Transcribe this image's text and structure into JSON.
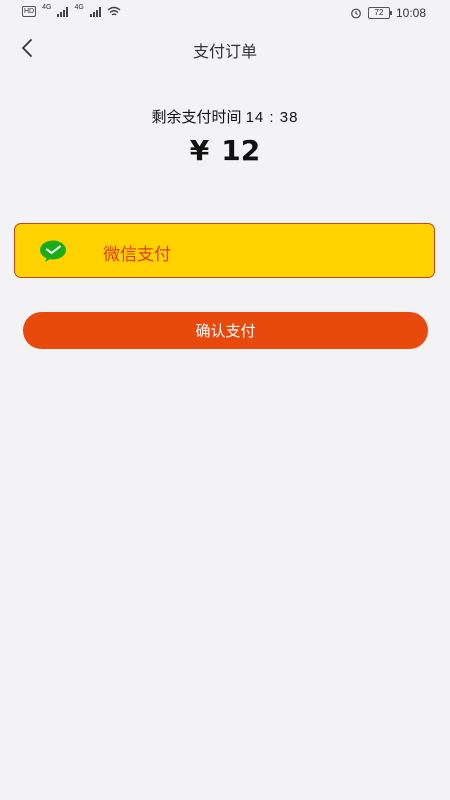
{
  "status_bar": {
    "hd_label": "HD",
    "net1": "4G",
    "net2": "4G",
    "battery": "72",
    "time": "10:08"
  },
  "nav": {
    "title": "支付订单",
    "back_icon": "chevron-left-icon"
  },
  "countdown": {
    "label": "剩余支付时间",
    "value": "14 : 38"
  },
  "amount": {
    "currency": "¥",
    "value": "12"
  },
  "payment_option": {
    "icon": "wechat-pay-icon",
    "label": "微信支付",
    "selected": true
  },
  "confirm": {
    "label": "确认支付"
  },
  "colors": {
    "background": "#f3f3f6",
    "option_bg": "#ffd200",
    "option_border": "#c9451a",
    "option_text": "#e03a12",
    "confirm_bg": "#e84a0e",
    "wechat_green": "#1aad19"
  }
}
